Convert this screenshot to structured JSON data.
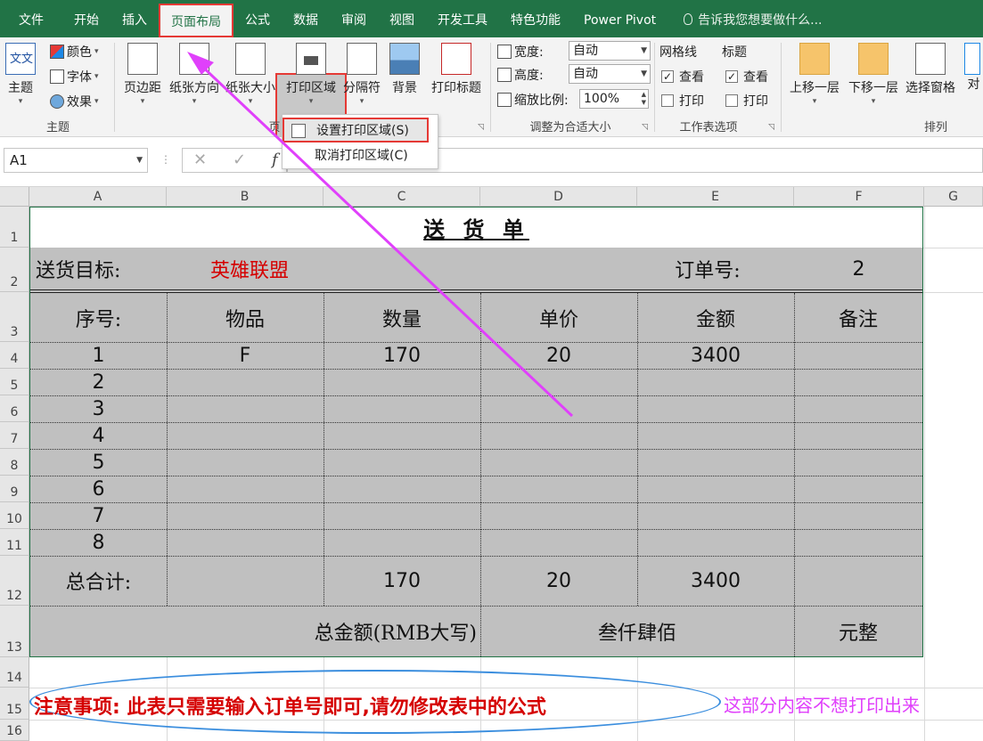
{
  "tabs": [
    {
      "label": "文件"
    },
    {
      "label": "开始"
    },
    {
      "label": "插入"
    },
    {
      "label": "页面布局"
    },
    {
      "label": "公式"
    },
    {
      "label": "数据"
    },
    {
      "label": "审阅"
    },
    {
      "label": "视图"
    },
    {
      "label": "开发工具"
    },
    {
      "label": "特色功能"
    },
    {
      "label": "Power Pivot"
    }
  ],
  "tell_me": "告诉我您想要做什么...",
  "ribbon": {
    "theme": {
      "main": "主题",
      "color": "颜色",
      "font": "字体",
      "effect": "效果",
      "group": "主题"
    },
    "page_setup": {
      "margins": "页边距",
      "orientation": "纸张方向",
      "size": "纸张大小",
      "print_area": "打印区域",
      "breaks": "分隔符",
      "background": "背景",
      "print_titles": "打印标题",
      "group_fragment": "页"
    },
    "scale": {
      "width_label": "宽度:",
      "width_value": "自动",
      "height_label": "高度:",
      "height_value": "自动",
      "scale_label": "缩放比例:",
      "scale_value": "100%",
      "group": "调整为合适大小"
    },
    "sheet_options": {
      "gridlines": "网格线",
      "headings": "标题",
      "view": "查看",
      "print": "打印",
      "group": "工作表选项"
    },
    "arrange": {
      "bring_forward": "上移一层",
      "send_backward": "下移一层",
      "selection_pane": "选择窗格",
      "align": "对",
      "group": "排列"
    }
  },
  "dropdown": {
    "set_print_area": "设置打印区域(S)",
    "clear_print_area": "取消打印区域(C)"
  },
  "formula_bar": {
    "name_box": "A1",
    "cancel": "✕",
    "enter": "✓",
    "fx": "f"
  },
  "columns": [
    "A",
    "B",
    "C",
    "D",
    "E",
    "F",
    "G"
  ],
  "rows": [
    "1",
    "2",
    "3",
    "4",
    "5",
    "6",
    "7",
    "8",
    "9",
    "10",
    "11",
    "12",
    "13",
    "14",
    "15",
    "16"
  ],
  "sheet": {
    "title": "送 货 单",
    "target_label": "送货目标:",
    "target_value": "英雄联盟",
    "order_label": "订单号:",
    "order_value": "2",
    "headers": [
      "序号:",
      "物品",
      "数量",
      "单价",
      "金额",
      "备注"
    ],
    "rows": [
      [
        "1",
        "F",
        "170",
        "20",
        "3400",
        ""
      ],
      [
        "2",
        "",
        "",
        "",
        "",
        ""
      ],
      [
        "3",
        "",
        "",
        "",
        "",
        ""
      ],
      [
        "4",
        "",
        "",
        "",
        "",
        ""
      ],
      [
        "5",
        "",
        "",
        "",
        "",
        ""
      ],
      [
        "6",
        "",
        "",
        "",
        "",
        ""
      ],
      [
        "7",
        "",
        "",
        "",
        "",
        ""
      ],
      [
        "8",
        "",
        "",
        "",
        "",
        ""
      ]
    ],
    "total_label": "总合计:",
    "total_qty": "170",
    "total_price": "20",
    "total_amount": "3400",
    "amount_label": "总金额(RMB大写)",
    "amount_words": "叁仟肆佰",
    "amount_unit": "元整"
  },
  "annotation": {
    "note": "注意事项:  此表只需要输入订单号即可,请勿修改表中的公式",
    "side": "这部分内容不想打印出来"
  },
  "colors": {
    "ribbon_green": "#217346",
    "highlight_red": "#e53935",
    "arrow_magenta": "#e040fb",
    "note_red": "#d50000",
    "ellipse_blue": "#3b8ede",
    "table_gray": "#c0c0c0"
  }
}
